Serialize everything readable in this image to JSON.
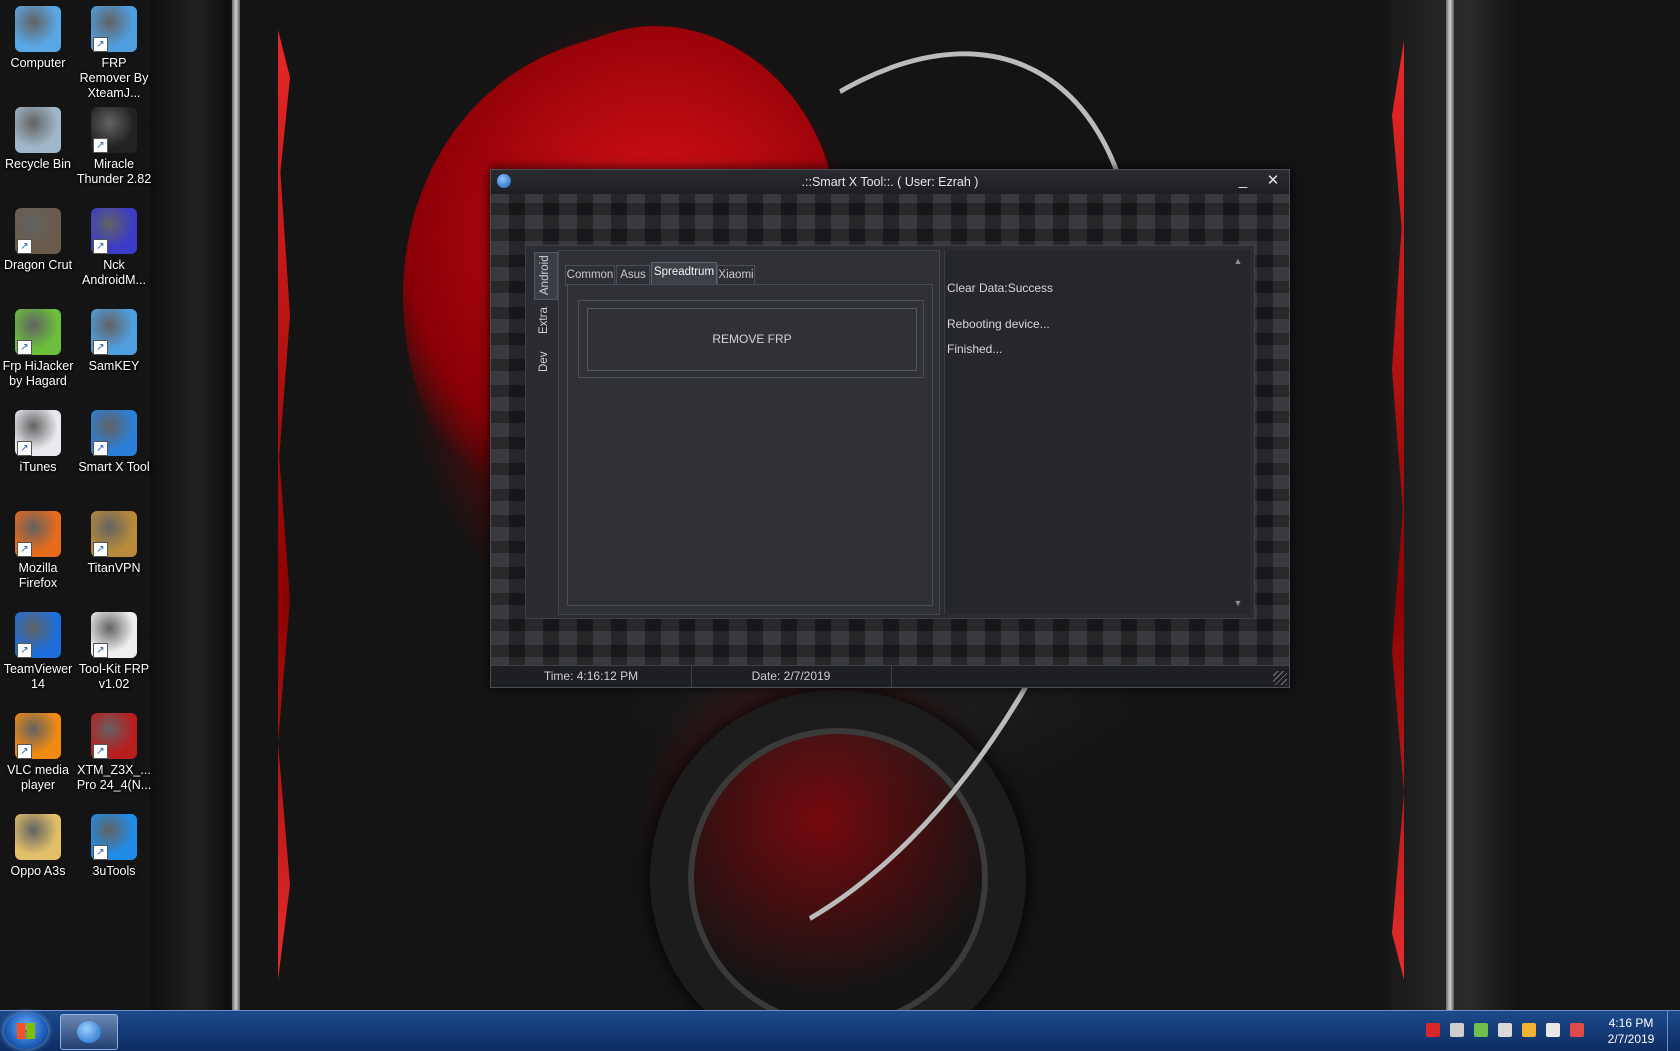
{
  "desktop_icons": [
    {
      "id": "computer",
      "label": "Computer",
      "icon": "computer-icon",
      "color": "#5aa7e6"
    },
    {
      "id": "frp-remover",
      "label": "FRP Remover By XteamJ...",
      "icon": "key-icon",
      "color": "#4f9fe0"
    },
    {
      "id": "recycle-bin",
      "label": "Recycle Bin",
      "icon": "recycle-bin-icon",
      "color": "#9fb7c9"
    },
    {
      "id": "miracle",
      "label": "Miracle Thunder 2.82",
      "icon": "gsm-team-icon",
      "color": "#222222"
    },
    {
      "id": "dragon-crut",
      "label": "Dragon Crut",
      "icon": "photo-icon",
      "color": "#6a5a4a"
    },
    {
      "id": "nck",
      "label": "Nck AndroidM...",
      "icon": "nck-icon",
      "color": "#3b3bc8"
    },
    {
      "id": "frp-hijacker",
      "label": "Frp HiJacker by Hagard",
      "icon": "frp-icon",
      "color": "#6cbf3d"
    },
    {
      "id": "samkey",
      "label": "SamKEY",
      "icon": "key-shield-icon",
      "color": "#4f9fe0"
    },
    {
      "id": "itunes",
      "label": "iTunes",
      "icon": "itunes-icon",
      "color": "#e9e9ef"
    },
    {
      "id": "smart-x",
      "label": "Smart X Tool",
      "icon": "android-icon",
      "color": "#2b7fd6"
    },
    {
      "id": "firefox",
      "label": "Mozilla Firefox",
      "icon": "firefox-icon",
      "color": "#e76b1c"
    },
    {
      "id": "titanvpn",
      "label": "TitanVPN",
      "icon": "vpn-shield-icon",
      "color": "#b88a3a"
    },
    {
      "id": "teamviewer",
      "label": "TeamViewer 14",
      "icon": "teamviewer-icon",
      "color": "#1e6fd9"
    },
    {
      "id": "toolkit-frp",
      "label": "Tool-Kit FRP v1.02",
      "icon": "gorilla-icon",
      "color": "#eeeeee"
    },
    {
      "id": "vlc",
      "label": "VLC media player",
      "icon": "vlc-icon",
      "color": "#f08a12"
    },
    {
      "id": "xtm",
      "label": "XTM_Z3X_... Pro 24_4(N...",
      "icon": "gear-icon",
      "color": "#b81e1e"
    },
    {
      "id": "oppo",
      "label": "Oppo A3s",
      "icon": "folder-icon",
      "color": "#e2c06a"
    },
    {
      "id": "3utools",
      "label": "3uTools",
      "icon": "3utools-icon",
      "color": "#1f8ce8"
    }
  ],
  "window": {
    "title": ".::Smart X Tool::.   ( User: Ezrah )",
    "minimize": "_",
    "close": "✕",
    "vertical_tabs": [
      "Android",
      "Extra",
      "Dev"
    ],
    "active_vertical_tab": "Android",
    "tabs": [
      "Common",
      "Asus",
      "Spreadtrum",
      "Xiaomi"
    ],
    "active_tab": "Spreadtrum",
    "remove_frp_label": "REMOVE FRP",
    "log": [
      "Clear Data:Success",
      "Rebooting device...",
      "Finished..."
    ],
    "status": {
      "time": "Time: 4:16:12 PM",
      "date": "Date: 2/7/2019"
    }
  },
  "taskbar": {
    "clock_time": "4:16 PM",
    "clock_date": "2/7/2019",
    "tray_icons": [
      "antivirus-icon",
      "usb-device-icon",
      "network-icon",
      "volume-icon",
      "weather-icon",
      "browser-icon",
      "action-center-flag-icon"
    ]
  },
  "colors": {
    "accent": "#1d4a8c",
    "wallpaper_red": "#c80a0f",
    "window_bg": "#1b1c1f"
  }
}
